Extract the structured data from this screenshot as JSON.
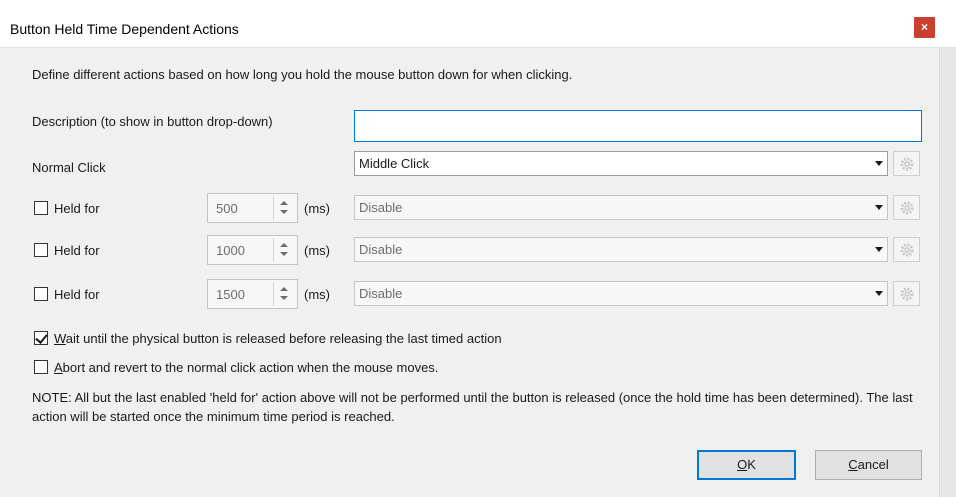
{
  "window": {
    "title": "Button Held Time Dependent Actions",
    "close_label": "×"
  },
  "intro_text": "Define different actions based on how long you hold the mouse button down for when clicking.",
  "description": {
    "label": "Description (to show in button drop-down)",
    "value": ""
  },
  "normal_click": {
    "label": "Normal Click",
    "selected": "Middle Click"
  },
  "held_rows": [
    {
      "checked": false,
      "label": "Held for",
      "ms_value": "500",
      "unit": "(ms)",
      "action": "Disable"
    },
    {
      "checked": false,
      "label": "Held for",
      "ms_value": "1000",
      "unit": "(ms)",
      "action": "Disable"
    },
    {
      "checked": false,
      "label": "Held for",
      "ms_value": "1500",
      "unit": "(ms)",
      "action": "Disable"
    }
  ],
  "options": {
    "wait_release": {
      "checked": true,
      "label_first": "W",
      "label_rest": "ait until the physical button is released before releasing the last timed action"
    },
    "abort_revert": {
      "checked": false,
      "label_first": "A",
      "label_rest": "bort and revert to the normal click action when the mouse moves."
    }
  },
  "note": "NOTE: All but the last enabled 'held for' action above will not be performed until the button is released (once the hold time has been determined). The last action will be started once the minimum time period is reached.",
  "buttons": {
    "ok_first": "O",
    "ok_rest": "K",
    "cancel_first": "C",
    "cancel_rest": "ancel"
  },
  "colors": {
    "close_button": "#c9402f",
    "focus_border": "#0078d7",
    "dialog_bg": "#f0f0f0"
  }
}
